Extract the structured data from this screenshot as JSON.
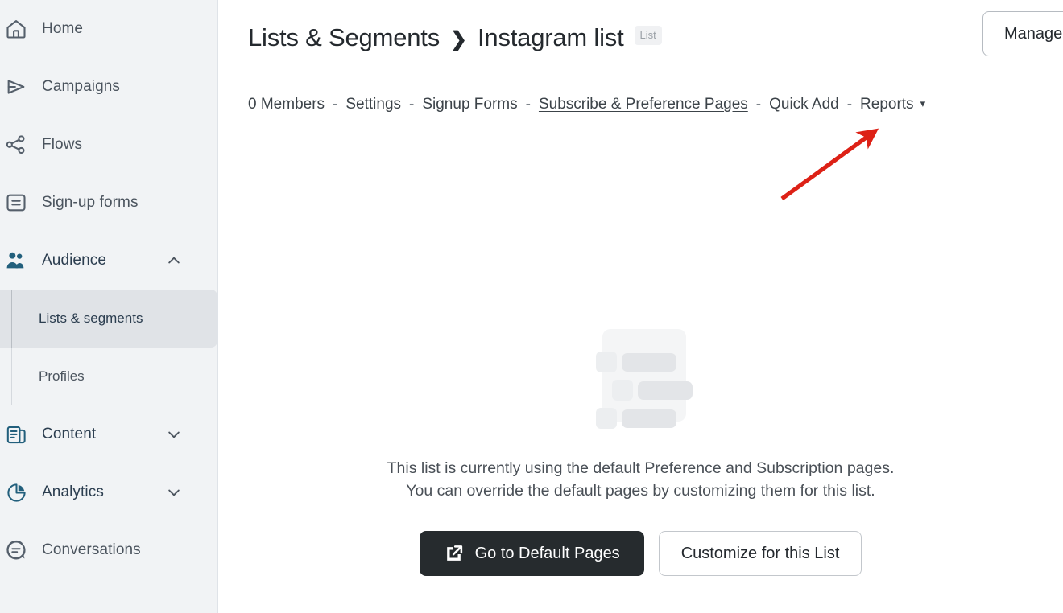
{
  "sidebar": {
    "items": [
      {
        "label": "Home",
        "icon": "home-icon",
        "type": "link"
      },
      {
        "label": "Campaigns",
        "icon": "send-icon",
        "type": "link"
      },
      {
        "label": "Flows",
        "icon": "flows-icon",
        "type": "link"
      },
      {
        "label": "Sign-up forms",
        "icon": "signup-forms-icon",
        "type": "link"
      },
      {
        "label": "Audience",
        "icon": "audience-icon",
        "type": "section",
        "expanded": true,
        "chevron": "chevron-up-icon"
      },
      {
        "label": "Content",
        "icon": "content-icon",
        "type": "section",
        "expanded": false,
        "chevron": "chevron-down-icon"
      },
      {
        "label": "Analytics",
        "icon": "analytics-icon",
        "type": "section",
        "expanded": false,
        "chevron": "chevron-down-icon"
      },
      {
        "label": "Conversations",
        "icon": "conversations-icon",
        "type": "link"
      }
    ],
    "audience_children": [
      {
        "label": "Lists & segments",
        "active": true
      },
      {
        "label": "Profiles",
        "active": false
      }
    ],
    "active_item": "Lists & segments",
    "background_color": "#f1f3f5",
    "active_highlight_color": "#e0e3e7"
  },
  "header": {
    "breadcrumb": {
      "parent": "Lists & Segments",
      "separator": "❯",
      "current": "Instagram list"
    },
    "badge": "List",
    "manage_label": "Manage"
  },
  "tabs": [
    {
      "label": "0 Members",
      "active": false
    },
    {
      "label": "Settings",
      "active": false
    },
    {
      "label": "Signup Forms",
      "active": false
    },
    {
      "label": "Subscribe & Preference Pages",
      "active": true
    },
    {
      "label": "Quick Add",
      "active": false
    },
    {
      "label": "Reports",
      "active": false,
      "has_caret": true
    }
  ],
  "tab_separator": "-",
  "reports_caret": "▾",
  "empty_state": {
    "illustration": "preference-pages-placeholder-illustration",
    "message": "This list is currently using the default Preference and Subscription pages. You can override the default pages by customizing them for this list.",
    "primary_button": {
      "label": "Go to Default Pages",
      "icon": "external-link-icon",
      "background_color": "#262b2e",
      "text_color": "#ffffff"
    },
    "secondary_button": {
      "label": "Customize for this List",
      "background_color": "#ffffff",
      "text_color": "#24292e"
    }
  },
  "annotation": {
    "type": "arrow",
    "color": "#dd2116",
    "points_to": "Subscribe & Preference Pages"
  }
}
